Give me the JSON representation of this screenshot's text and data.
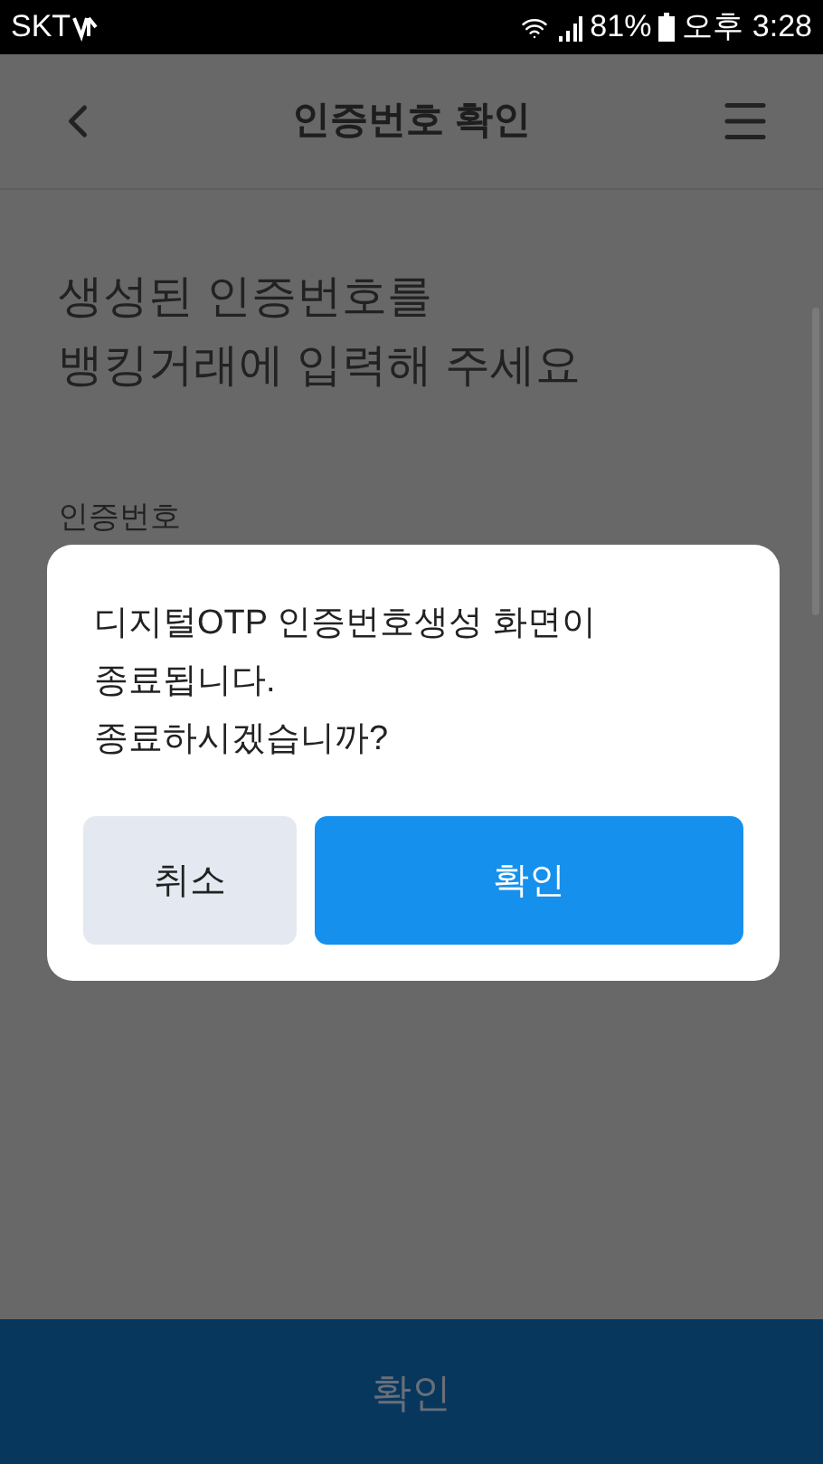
{
  "status_bar": {
    "carrier": "SKT",
    "battery": "81%",
    "time": "오후 3:28"
  },
  "header": {
    "title": "인증번호 확인"
  },
  "instruction": [
    "생성된 인증번호를",
    "뱅킹거래에 입력해 주세요"
  ],
  "field_label": "인증번호",
  "dialog": {
    "message": [
      "디지털OTP 인증번호생성 화면이",
      "종료됩니다.",
      "종료하시겠습니까?"
    ],
    "buttons": [
      {
        "label": "취소",
        "kind": "secondary"
      },
      {
        "label": "확인",
        "kind": "primary"
      }
    ]
  },
  "bottom_button": {
    "label": "확인"
  }
}
